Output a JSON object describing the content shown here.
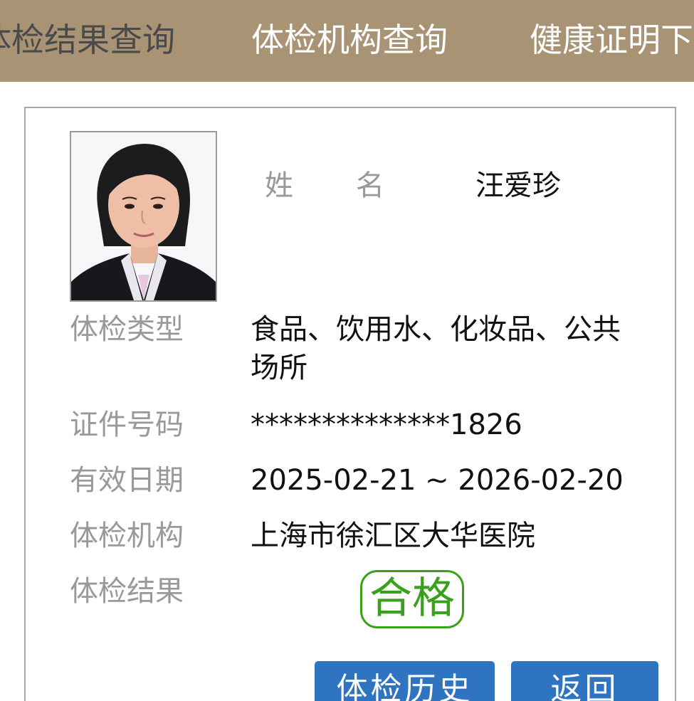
{
  "nav": {
    "tabs": [
      {
        "label": "体检结果查询",
        "active": true
      },
      {
        "label": "体检机构查询",
        "active": false
      },
      {
        "label": "健康证明下载",
        "active": false
      }
    ]
  },
  "card": {
    "name_label_1": "姓",
    "name_label_2": "名",
    "name": "汪爱珍",
    "exam_type_label": "体检类型",
    "exam_type": "食品、饮用水、化妆品、公共场所",
    "id_label": "证件号码",
    "id_number": "**************1826",
    "valid_label": "有效日期",
    "valid_period": "2025-02-21 ~ 2026-02-20",
    "org_label": "体检机构",
    "org": "上海市徐汇区大华医院",
    "result_label": "体检结果",
    "result": "合格"
  },
  "buttons": {
    "history": "体检历史",
    "back": "返回"
  },
  "colors": {
    "topbar": "#a89474",
    "stamp": "#3aa21a",
    "button": "#2f74c0",
    "label": "#999999"
  }
}
